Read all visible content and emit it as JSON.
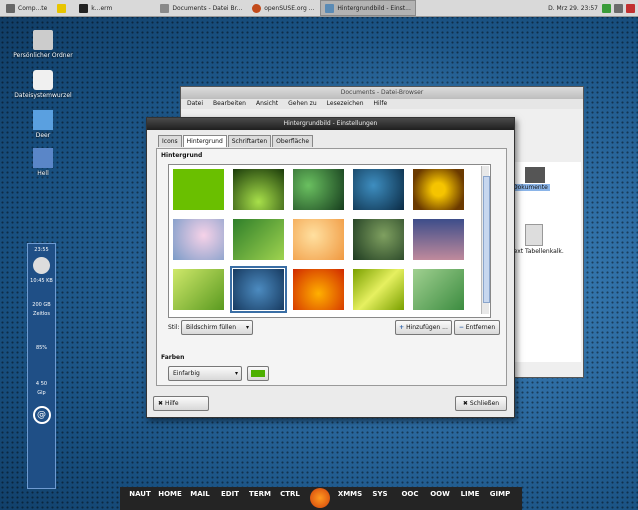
{
  "topbar": {
    "items": [
      "Comp...te",
      "",
      "k...erm",
      "Documents - Datei Br...",
      "openSUSE.org ...",
      "Hintergrundbild - Einst..."
    ],
    "clock": "D. Mrz 29. 23:57"
  },
  "desktop": {
    "icons": [
      {
        "label": "Persönlicher Ordner"
      },
      {
        "label": "Dateisystemwurzel"
      },
      {
        "label": "Deer"
      },
      {
        "label": "Hell"
      }
    ]
  },
  "sidepanel": {
    "lines": [
      "23:55",
      "",
      "10:45 KB",
      "",
      "200 GB",
      "Zeitlos",
      "",
      "85%",
      "",
      "4 50",
      "Glp"
    ]
  },
  "back_window": {
    "title": "Documents - Datei-Browser",
    "menu": [
      "Datei",
      "Bearbeiten",
      "Ansicht",
      "Gehen zu",
      "Lesezeichen",
      "Hilfe"
    ],
    "files": [
      {
        "label": "Dokumente"
      },
      {
        "label": "Text Tabellenkalk."
      }
    ]
  },
  "dialog": {
    "title": "Hintergrundbild - Einstellungen",
    "tabs": [
      "Icons",
      "Hintergrund",
      "Schriftarten",
      "Oberfläche"
    ],
    "section_label": "Hintergrund",
    "stil_label": "Stil:",
    "stil_value": "Bildschirm füllen",
    "add_button": "Hinzufügen ...",
    "remove_button": "Entfernen",
    "farben_label": "Farben",
    "farben_value": "Einfarbig",
    "help_button": "Hilfe",
    "close_button": "Schließen"
  },
  "taskbar": {
    "labels": [
      "NAUT",
      "HOME",
      "MAIL",
      "EDIT",
      "TERM",
      "CTRL",
      "",
      "XMMS",
      "SYS",
      "OOC",
      "OOW",
      "LIME",
      "GIMP"
    ]
  }
}
